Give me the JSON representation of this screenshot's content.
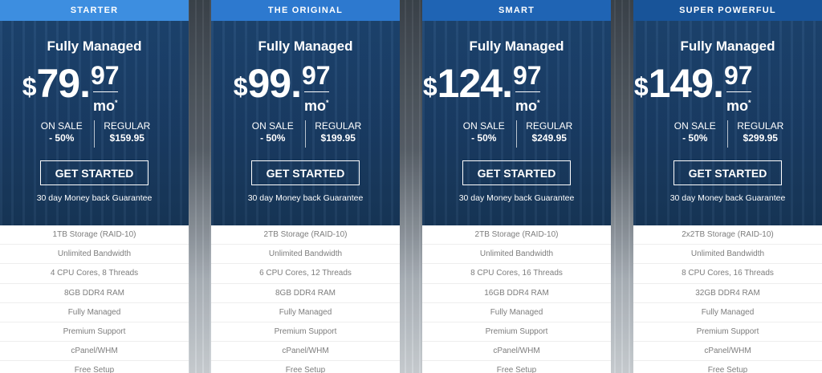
{
  "plans": [
    {
      "name": "STARTER",
      "header_color": "#3d8ee0",
      "subtitle": "Fully Managed",
      "currency": "$",
      "price_whole": "79.",
      "price_cents": "97",
      "price_unit": "mo",
      "price_unit_mark": "*",
      "sale_label": "ON SALE",
      "sale_value": "- 50%",
      "regular_label": "REGULAR",
      "regular_value": "$159.95",
      "cta": "GET STARTED",
      "guarantee": "30 day Money back Guarantee",
      "features": [
        "1TB Storage (RAID-10)",
        "Unlimited Bandwidth",
        "4 CPU Cores, 8 Threads",
        "8GB DDR4 RAM",
        "Fully Managed",
        "Premium Support",
        "cPanel/WHM",
        "Free Setup"
      ]
    },
    {
      "name": "THE ORIGINAL",
      "header_color": "#2d79cf",
      "subtitle": "Fully Managed",
      "currency": "$",
      "price_whole": "99.",
      "price_cents": "97",
      "price_unit": "mo",
      "price_unit_mark": "*",
      "sale_label": "ON SALE",
      "sale_value": "- 50%",
      "regular_label": "REGULAR",
      "regular_value": "$199.95",
      "cta": "GET STARTED",
      "guarantee": "30 day Money back Guarantee",
      "features": [
        "2TB Storage (RAID-10)",
        "Unlimited Bandwidth",
        "6 CPU Cores, 12 Threads",
        "8GB DDR4 RAM",
        "Fully Managed",
        "Premium Support",
        "cPanel/WHM",
        "Free Setup"
      ]
    },
    {
      "name": "SMART",
      "header_color": "#1f64b4",
      "subtitle": "Fully Managed",
      "currency": "$",
      "price_whole": "124.",
      "price_cents": "97",
      "price_unit": "mo",
      "price_unit_mark": "*",
      "sale_label": "ON SALE",
      "sale_value": "- 50%",
      "regular_label": "REGULAR",
      "regular_value": "$249.95",
      "cta": "GET STARTED",
      "guarantee": "30 day Money back Guarantee",
      "features": [
        "2TB Storage (RAID-10)",
        "Unlimited Bandwidth",
        "8 CPU Cores, 16 Threads",
        "16GB DDR4 RAM",
        "Fully Managed",
        "Premium Support",
        "cPanel/WHM",
        "Free Setup"
      ]
    },
    {
      "name": "SUPER POWERFUL",
      "header_color": "#185499",
      "subtitle": "Fully Managed",
      "currency": "$",
      "price_whole": "149.",
      "price_cents": "97",
      "price_unit": "mo",
      "price_unit_mark": "*",
      "sale_label": "ON SALE",
      "sale_value": "- 50%",
      "regular_label": "REGULAR",
      "regular_value": "$299.95",
      "cta": "GET STARTED",
      "guarantee": "30 day Money back Guarantee",
      "features": [
        "2x2TB Storage (RAID-10)",
        "Unlimited Bandwidth",
        "8 CPU Cores, 16 Threads",
        "32GB DDR4 RAM",
        "Fully Managed",
        "Premium Support",
        "cPanel/WHM",
        "Free Setup"
      ]
    }
  ]
}
